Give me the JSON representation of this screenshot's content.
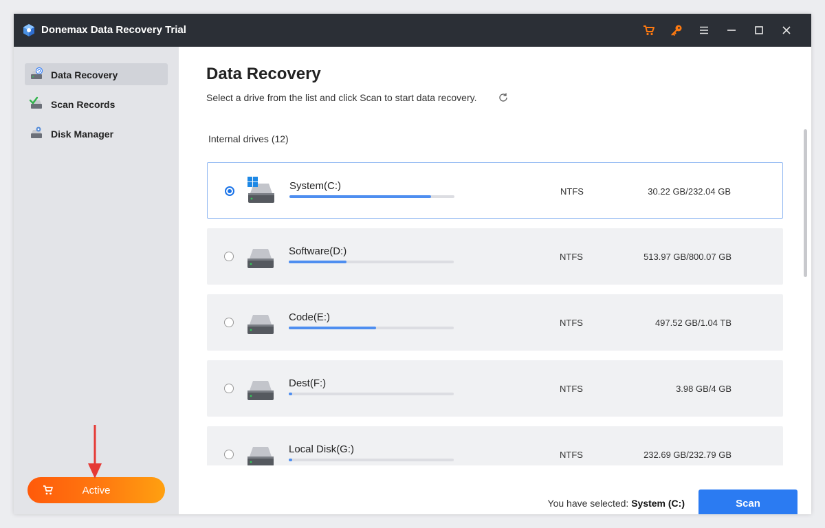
{
  "window": {
    "title": "Donemax Data Recovery Trial"
  },
  "titlebar_icons": [
    "cart-icon",
    "key-icon",
    "menu-icon",
    "minimize-icon",
    "maximize-icon",
    "close-icon"
  ],
  "colors": {
    "titlebar": "#2b2f36",
    "accent": "#2b7bf2",
    "active_gradient": [
      "#ff5a0a",
      "#ffa010"
    ],
    "arrow": "#e53935"
  },
  "sidebar": {
    "items": [
      {
        "label": "Data Recovery",
        "icon": "drive-recovery-icon",
        "active": true
      },
      {
        "label": "Scan Records",
        "icon": "scan-records-icon",
        "active": false
      },
      {
        "label": "Disk Manager",
        "icon": "disk-manager-icon",
        "active": false
      }
    ],
    "active_button": {
      "label": "Active",
      "icon": "cart-icon"
    }
  },
  "main": {
    "title": "Data Recovery",
    "subtitle": "Select a drive from the list and click Scan to start data recovery.",
    "section_label": "Internal drives (12)",
    "drives": [
      {
        "name": "System(C:)",
        "fs": "NTFS",
        "capacity": "30.22 GB/232.04 GB",
        "used_fraction": 0.86,
        "selected": true,
        "os_drive": true
      },
      {
        "name": "Software(D:)",
        "fs": "NTFS",
        "capacity": "513.97 GB/800.07 GB",
        "used_fraction": 0.35,
        "selected": false,
        "os_drive": false
      },
      {
        "name": "Code(E:)",
        "fs": "NTFS",
        "capacity": "497.52 GB/1.04 TB",
        "used_fraction": 0.53,
        "selected": false,
        "os_drive": false
      },
      {
        "name": "Dest(F:)",
        "fs": "NTFS",
        "capacity": "3.98 GB/4 GB",
        "used_fraction": 0.02,
        "selected": false,
        "os_drive": false
      },
      {
        "name": "Local Disk(G:)",
        "fs": "NTFS",
        "capacity": "232.69 GB/232.79 GB",
        "used_fraction": 0.02,
        "selected": false,
        "os_drive": false
      }
    ],
    "footer": {
      "selected_prefix": "You have selected:",
      "selected_value": "System (C:)",
      "scan_label": "Scan"
    }
  }
}
